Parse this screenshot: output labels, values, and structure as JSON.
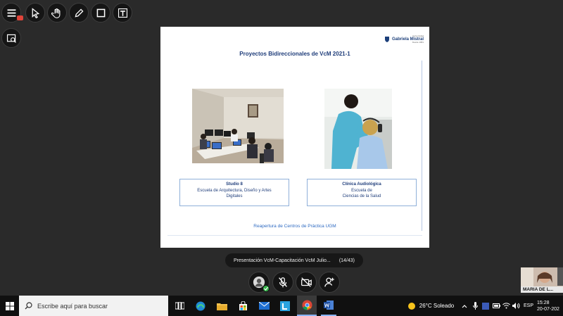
{
  "toolbar": {
    "tools": [
      {
        "name": "menu",
        "icon": "hamburger-menu-icon"
      },
      {
        "name": "select",
        "icon": "cursor-arrow-icon"
      },
      {
        "name": "pan",
        "icon": "hand-icon"
      },
      {
        "name": "pen",
        "icon": "pencil-icon"
      },
      {
        "name": "shape",
        "icon": "square-icon"
      },
      {
        "name": "text",
        "icon": "text-tool-icon"
      },
      {
        "name": "screenshot",
        "icon": "screen-capture-icon"
      }
    ]
  },
  "slide": {
    "title": "Proyectos Bidireccionales de VcM 2021-1",
    "logo": {
      "small": "Universidad",
      "main": "Gabriela Mistral",
      "year": "Desde 1981"
    },
    "items": [
      {
        "caption_lines": [
          "Studio 8",
          "Escuela de Arquitectura, Diseño y Artes",
          "Digitales"
        ]
      },
      {
        "caption_lines": [
          "Clínica Audiológica",
          "Escuela de",
          "Ciencias de la Salud"
        ]
      }
    ],
    "footer": "Reapertura de Centros de Práctica UGM"
  },
  "presentation_bar": {
    "title": "Presentación VcM-Capacitación VcM Julio...",
    "counter": "(14/43)"
  },
  "call_controls": [
    {
      "name": "avatar",
      "icon": "user-avatar-icon"
    },
    {
      "name": "mic",
      "icon": "mic-off-icon"
    },
    {
      "name": "camera",
      "icon": "camera-off-icon"
    },
    {
      "name": "participants",
      "icon": "add-participant-icon"
    }
  ],
  "participant": {
    "name": "MARIA DE L..."
  },
  "taskbar": {
    "search_placeholder": "Escribe aquí para buscar",
    "weather": "26°C  Soleado",
    "language": "ESP",
    "time": "15:28",
    "date": "20-07-202"
  },
  "colors": {
    "background": "#2a2a2a",
    "slide_title": "#1f3d7a",
    "slide_link": "#2f6bc2",
    "caption_border": "#8fb0d9",
    "status_ok": "#35b44a"
  }
}
